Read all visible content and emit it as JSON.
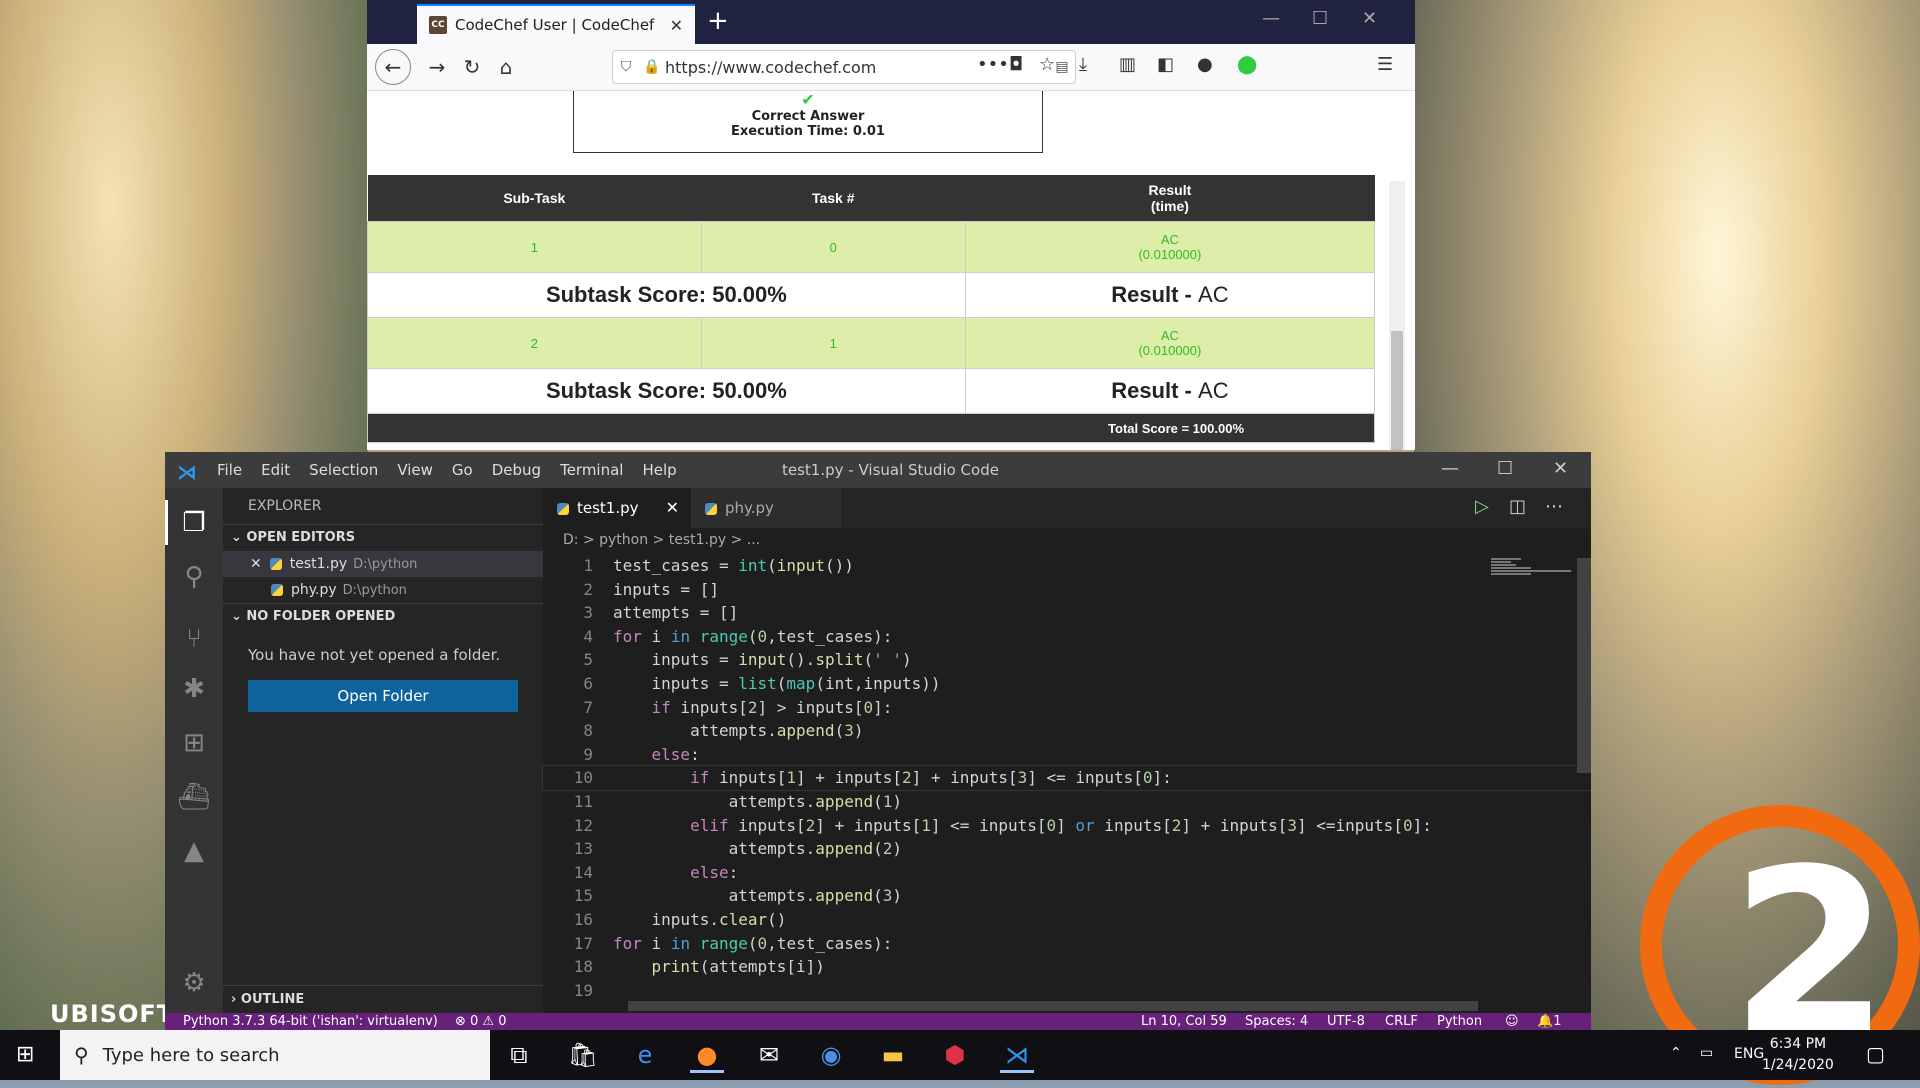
{
  "browser": {
    "tab_title": "CodeChef User | CodeChef",
    "tab_favicon": "CC",
    "url": "https://www.codechef.com",
    "verdict": "Correct Answer",
    "execution_time": "Execution Time: 0.01",
    "table": {
      "headers": [
        "Sub-Task",
        "Task #",
        "Result\n(time)"
      ],
      "rows": [
        {
          "subtask": "1",
          "task": "0",
          "result": "AC",
          "time": "(0.010000)"
        },
        {
          "subtask": "2",
          "task": "1",
          "result": "AC",
          "time": "(0.010000)"
        }
      ],
      "subtask_score": "Subtask Score: 50.00%",
      "result_label": "Result -",
      "result_value": "AC",
      "total_score": "Total Score = 100.00%"
    }
  },
  "vscode": {
    "menu": [
      "File",
      "Edit",
      "Selection",
      "View",
      "Go",
      "Debug",
      "Terminal",
      "Help"
    ],
    "window_title": "test1.py - Visual Studio Code",
    "explorer_title": "EXPLORER",
    "open_editors_label": "OPEN EDITORS",
    "open_editors": [
      {
        "name": "test1.py",
        "path": "D:\\python"
      },
      {
        "name": "phy.py",
        "path": "D:\\python"
      }
    ],
    "no_folder_label": "NO FOLDER OPENED",
    "no_folder_msg": "You have not yet opened a folder.",
    "open_folder_button": "Open Folder",
    "outline_label": "OUTLINE",
    "tabs": [
      "test1.py",
      "phy.py"
    ],
    "breadcrumb": "D: > python > test1.py > ...",
    "code_lines": [
      "test_cases = int(input())",
      "inputs = []",
      "attempts = []",
      "for i in range(0,test_cases):",
      "    inputs = input().split(' ')",
      "    inputs = list(map(int,inputs))",
      "    if inputs[2] > inputs[0]:",
      "        attempts.append(3)",
      "    else:",
      "        if inputs[1] + inputs[2] + inputs[3] <= inputs[0]:",
      "            attempts.append(1)",
      "        elif inputs[2] + inputs[1] <= inputs[0] or inputs[2] + inputs[3] <=inputs[0]:",
      "            attempts.append(2)",
      "        else:",
      "            attempts.append(3)",
      "    inputs.clear()",
      "for i in range(0,test_cases):",
      "    print(attempts[i])",
      ""
    ],
    "status": {
      "interpreter": "Python 3.7.3 64-bit ('ishan': virtualenv)",
      "problems": "⊗ 0 ⚠ 0",
      "position": "Ln 10, Col 59",
      "spaces": "Spaces: 4",
      "encoding": "UTF-8",
      "eol": "CRLF",
      "language": "Python",
      "notifications": "1"
    }
  },
  "taskbar": {
    "search_placeholder": "Type here to search",
    "language": "ENG",
    "time": "6:34 PM",
    "date": "1/24/2020"
  },
  "wallpaper": {
    "brand": "UBISOFT",
    "number": "2"
  },
  "colors": {
    "vscode_status": "#68217a",
    "ac_green": "#33bb22",
    "ac_row_bg": "#ddeeaa",
    "accent": "#0e639c"
  }
}
